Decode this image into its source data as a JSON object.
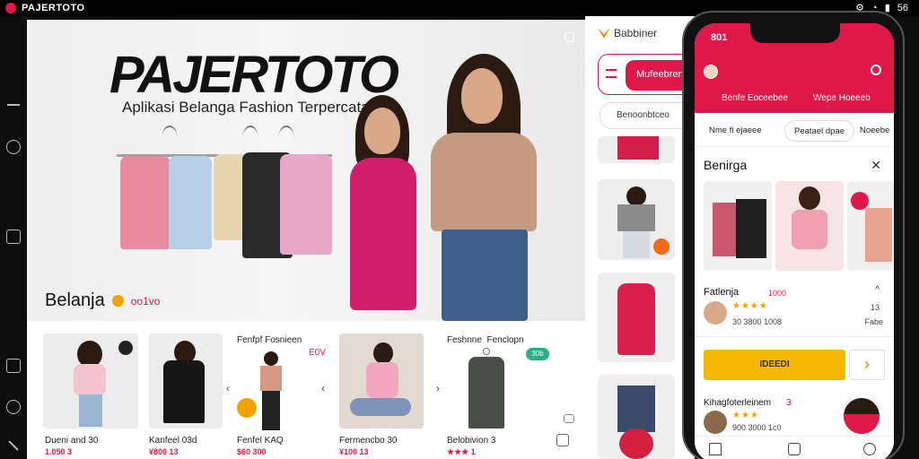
{
  "status_bar": {
    "app_title": "PAJERTOTO",
    "right_text": "56"
  },
  "hero": {
    "title": "PAJERTOTO",
    "subtitle": "Aplikasi Belanga Fashion Terpercata",
    "bottom_label": "Belanja",
    "bottom_tag": "oo1vo"
  },
  "products": [
    {
      "name": "Dueni and 30",
      "price": "1.050 3"
    },
    {
      "name": "Kanfeel 03d",
      "price": "¥800 13"
    },
    {
      "title": "Fenfpf Fosnieen",
      "sub": "E0V",
      "name": "Fenfel  KAQ",
      "price": "$60 300"
    },
    {
      "name": "Fermencbo 30",
      "price": "¥100 13"
    },
    {
      "title": "Feshnne  Fenclopn",
      "badge": "30b",
      "name": "Belobivion 3",
      "price": "★★★ 1"
    }
  ],
  "middle": {
    "brand": "Babbiner",
    "search_button": "Mufeebren",
    "chip": "Benoonbtceo"
  },
  "phone": {
    "time": "801",
    "brand": "  ",
    "tabs": [
      "Benfe Eoceebee",
      "Wepe Hoeeeb"
    ],
    "chips": [
      "Nme fi ejaeee",
      "Peatael dpae",
      "Noeebe"
    ],
    "section_title": "Benirga",
    "item1": {
      "name": "Fatlenja",
      "price": "1000",
      "rating": "★★★★",
      "meta": "30 3800 1008",
      "side_top": "13",
      "side_bottom": "Fabe"
    },
    "cta": "IDEEDI",
    "item2": {
      "name": "Kihagfoterleinem",
      "count": "3",
      "rating": "★★★",
      "meta": "900 3000 1c0"
    },
    "nav": [
      "home",
      "bag",
      "profile"
    ]
  },
  "colors": {
    "accent": "#e0184a",
    "cta_yellow": "#f5b800",
    "orange": "#f28a00"
  }
}
